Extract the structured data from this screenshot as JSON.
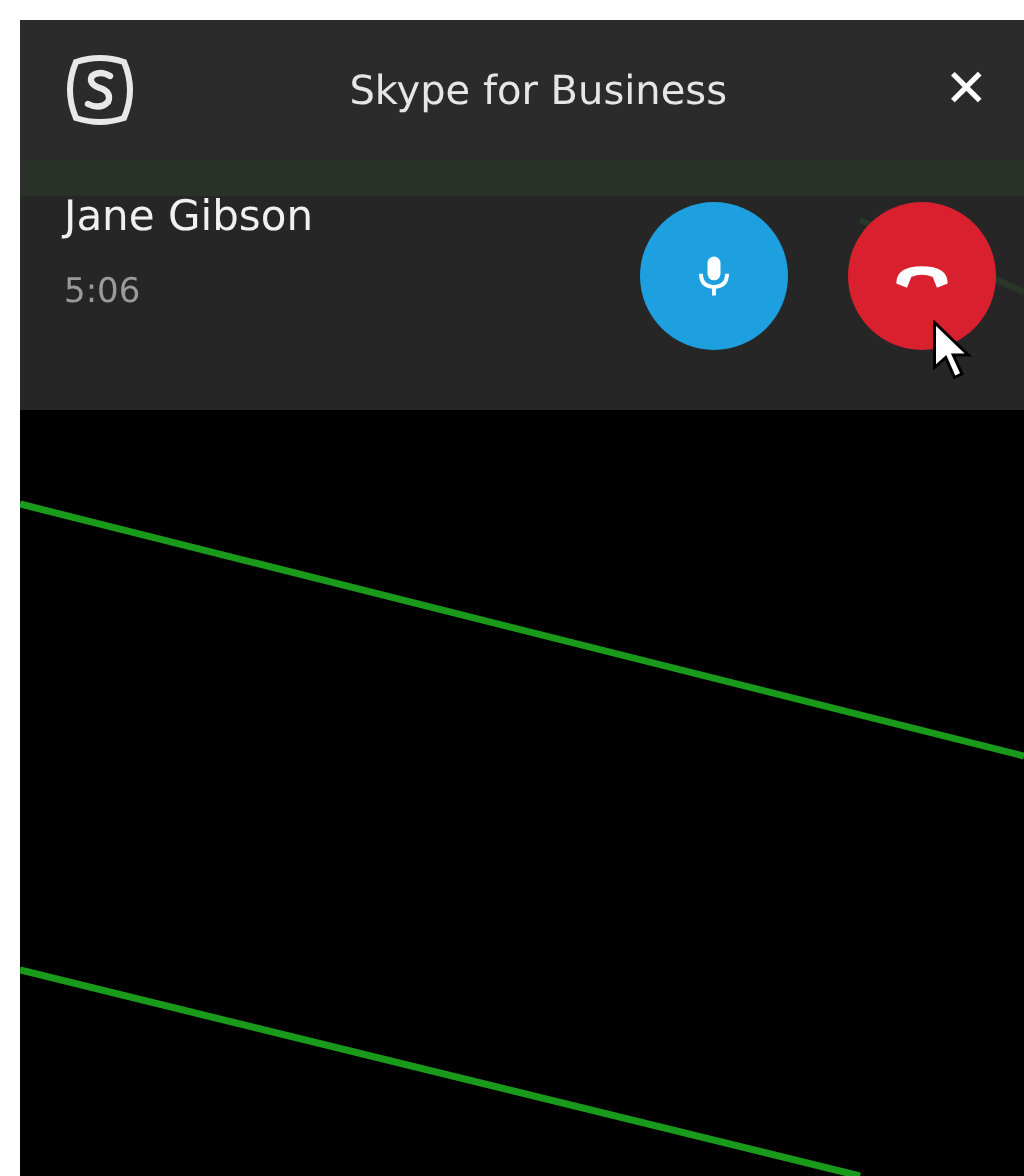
{
  "window": {
    "title": "Skype for Business",
    "close": "✕"
  },
  "call": {
    "caller": "Jane Gibson",
    "duration": "5:06"
  },
  "controls": [
    {
      "kind": "mic"
    },
    {
      "kind": "hangup"
    }
  ]
}
